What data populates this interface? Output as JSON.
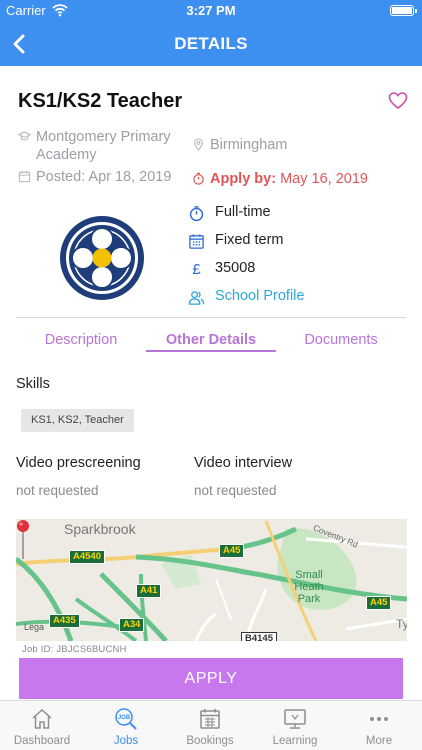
{
  "status_bar": {
    "carrier": "Carrier",
    "time": "3:27 PM"
  },
  "nav": {
    "title": "DETAILS",
    "back_icon": "chevron-left-icon"
  },
  "job": {
    "title": "KS1/KS2 Teacher",
    "school": "Montgomery Primary Academy",
    "posted": "Posted: Apr 18, 2019",
    "city": "Birmingham",
    "apply_by_label": "Apply by:",
    "apply_by_value": "May 16, 2019"
  },
  "facts": {
    "hours": "Full-time",
    "contract": "Fixed term",
    "currency_symbol": "£",
    "salary": "35008",
    "school_profile": "School Profile"
  },
  "tabs": [
    {
      "label": "Description"
    },
    {
      "label": "Other Details"
    },
    {
      "label": "Documents"
    }
  ],
  "details": {
    "skills_label": "Skills",
    "skills": "KS1, KS2, Teacher",
    "video_prescreening_label": "Video prescreening",
    "video_prescreening_value": "not requested",
    "video_interview_label": "Video interview",
    "video_interview_value": "not requested"
  },
  "map": {
    "area": "Sparkbrook",
    "park": [
      "Small",
      "Heath Park"
    ],
    "street": "Coventry Rd",
    "roads": [
      "A4540",
      "A45",
      "A41",
      "A435",
      "A34",
      "A45",
      "B4145"
    ],
    "legal": "Lega",
    "edge": "Ty"
  },
  "job_id": "Job ID: JBJCS6BUCNH",
  "apply_button": "APPLY",
  "tab_bar": [
    {
      "label": "Dashboard",
      "icon": "home-icon"
    },
    {
      "label": "Jobs",
      "icon": "jobs-search-icon"
    },
    {
      "label": "Bookings",
      "icon": "calendar-icon"
    },
    {
      "label": "Learning",
      "icon": "monitor-icon"
    },
    {
      "label": "More",
      "icon": "more-dots-icon"
    }
  ],
  "colors": {
    "primary": "#3d8ff0",
    "accent": "#c678ec",
    "alert": "#e05656",
    "link": "#2ea7dd"
  }
}
